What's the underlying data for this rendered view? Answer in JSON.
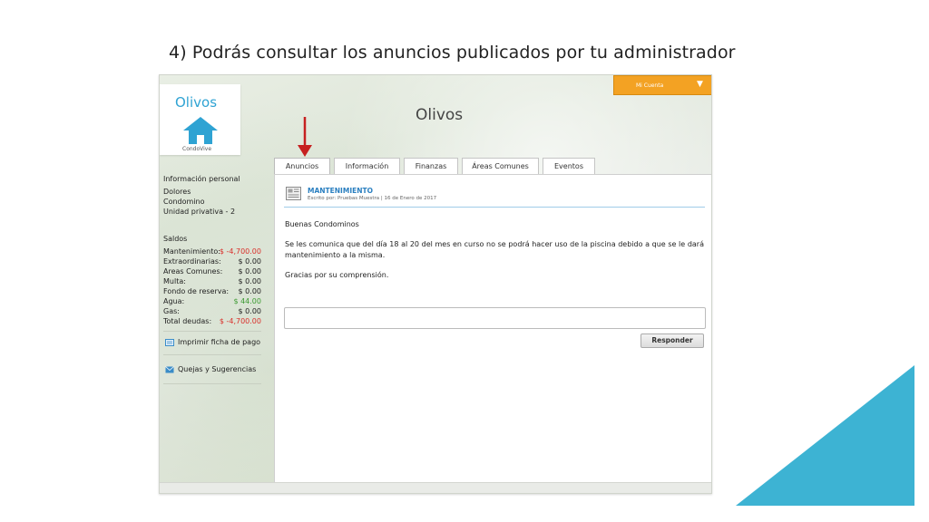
{
  "slide": {
    "title": "4) Podrás consultar los anuncios publicados por tu administrador",
    "accent_color": "#3db3d3"
  },
  "app": {
    "logo_text": "Olivos",
    "logo_icon": "home-icon",
    "logo_subtext": "CondoVive",
    "site_title": "Olivos",
    "account_menu": {
      "label": "Mi Cuenta",
      "icon": "caret-down-icon",
      "color": "#f3a223"
    }
  },
  "sidebar": {
    "personal_title": "Información personal",
    "personal_lines": [
      "Dolores",
      "Condomino",
      "Unidad privativa - 2"
    ],
    "balances_title": "Saldos",
    "balances": [
      {
        "label": "Mantenimiento:",
        "value": "$ -4,700.00",
        "status": "negative"
      },
      {
        "label": "Extraordinarias:",
        "value": "$ 0.00",
        "status": "neutral"
      },
      {
        "label": "Areas Comunes:",
        "value": "$ 0.00",
        "status": "neutral"
      },
      {
        "label": "Multa:",
        "value": "$ 0.00",
        "status": "neutral"
      },
      {
        "label": "Fondo de reserva:",
        "value": "$ 0.00",
        "status": "neutral"
      },
      {
        "label": "Agua:",
        "value": "$ 44.00",
        "status": "positive"
      },
      {
        "label": "Gas:",
        "value": "$ 0.00",
        "status": "neutral"
      },
      {
        "label": "Total deudas:",
        "value": "$ -4,700.00",
        "status": "negative"
      }
    ],
    "links": [
      {
        "label": "Imprimir ficha de pago",
        "icon": "printer-icon"
      },
      {
        "label": "Quejas y Sugerencias",
        "icon": "envelope-icon"
      }
    ]
  },
  "tabs": [
    {
      "label": "Anuncios",
      "active": true
    },
    {
      "label": "Información",
      "active": false
    },
    {
      "label": "Finanzas",
      "active": false
    },
    {
      "label": "Áreas Comunes",
      "active": false
    },
    {
      "label": "Eventos",
      "active": false
    }
  ],
  "announcement": {
    "icon": "newspaper-icon",
    "title": "MANTENIMIENTO",
    "meta": "Escrito por: Pruebas  Muestra | 16 de Enero de 2017",
    "greeting": "Buenas Condominos",
    "body": "Se les comunica que del día 18 al 20 del mes en curso no se podrá hacer uso de la piscina debido a que se le dará mantenimiento a la misma.",
    "closing": "Gracias por su comprensión."
  },
  "reply": {
    "placeholder": "",
    "button_label": "Responder"
  },
  "colors": {
    "negative": "#d9302b",
    "positive": "#3c9a32",
    "link": "#2a7fc0",
    "arrow": "#c62020"
  }
}
